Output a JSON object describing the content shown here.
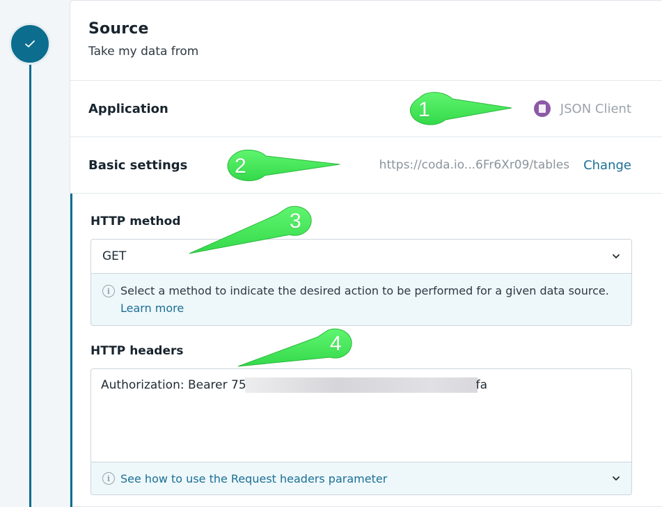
{
  "step": {
    "status_icon": "check-icon"
  },
  "source": {
    "title": "Source",
    "subtitle": "Take my data from"
  },
  "application": {
    "label": "Application",
    "value": "JSON Client",
    "icon": "json-app-icon"
  },
  "basic_settings": {
    "label": "Basic settings",
    "url": "https://coda.io...6Fr6Xr09/tables",
    "change_label": "Change"
  },
  "http_method": {
    "label": "HTTP method",
    "selected": "GET",
    "hint_text": "Select a method to indicate the desired action to be performed for a given data source.",
    "hint_link": "Learn more"
  },
  "http_headers": {
    "label": "HTTP headers",
    "value_prefix": "Authorization: Bearer 75",
    "value_suffix": "fa",
    "help_link": "See how to use the Request headers parameter"
  },
  "annotations": [
    "1",
    "2",
    "3",
    "4"
  ],
  "colors": {
    "accent": "#0c6d8e",
    "link": "#1a6f94",
    "callout": "#45e85a"
  }
}
